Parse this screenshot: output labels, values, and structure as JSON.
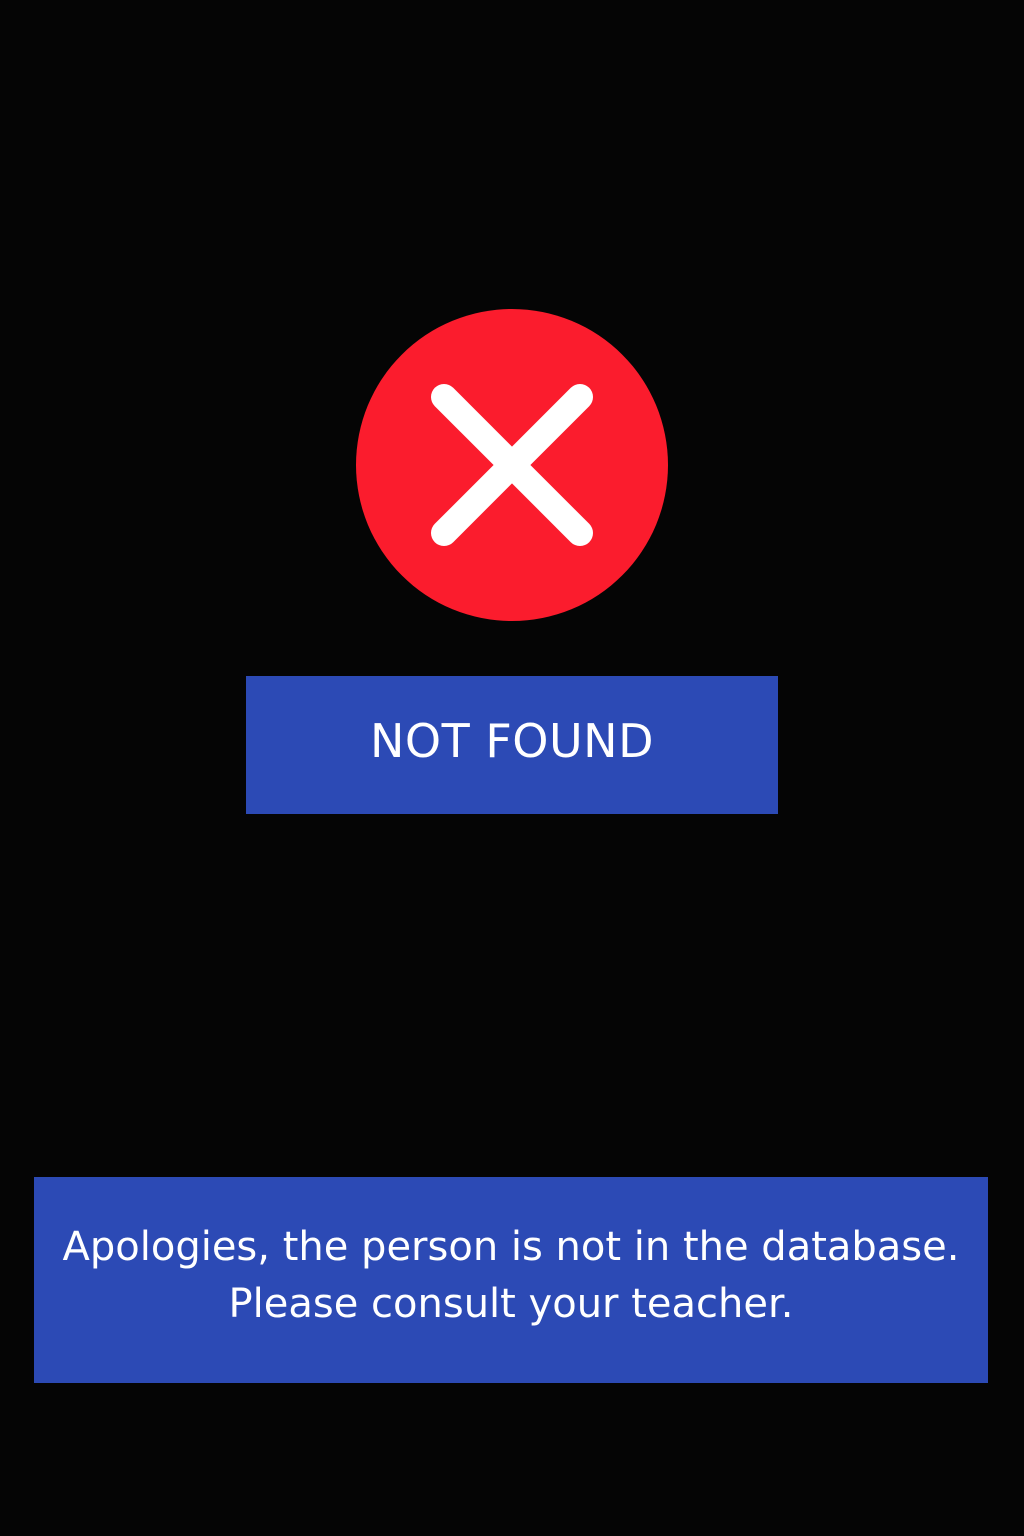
{
  "status": {
    "icon": "close-icon",
    "icon_color": "#fb1c2d",
    "title": "NOT FOUND"
  },
  "message": {
    "line1": "Apologies, the person is not in the database.",
    "line2": "Please consult your teacher."
  },
  "colors": {
    "background": "#050505",
    "panel": "#2c4ab5",
    "text": "#ffffff"
  }
}
